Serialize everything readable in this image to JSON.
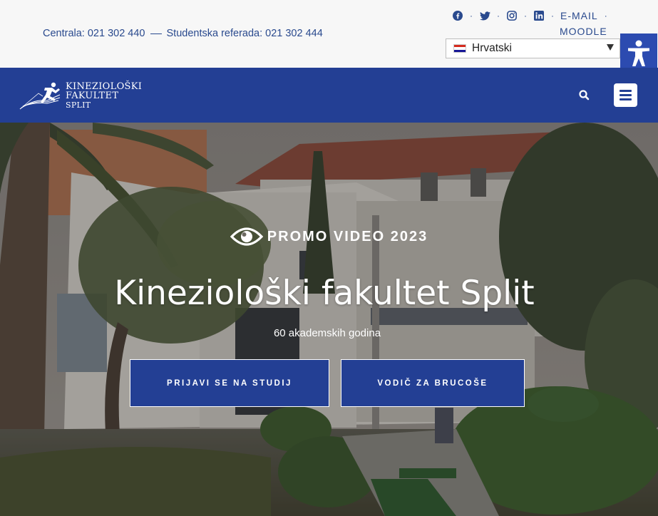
{
  "topbar": {
    "contact_central": "Centrala: 021 302 440",
    "contact_referada": "Studentska referada: 021 302 444",
    "links": {
      "facebook": "facebook-icon",
      "twitter": "twitter-icon",
      "instagram": "instagram-icon",
      "linkedin": "linkedin-icon",
      "email": "E-MAIL",
      "moodle": "MOODLE"
    },
    "language": {
      "selected": "Hrvatski",
      "flag_colors": [
        "#d52b1e",
        "#ffffff",
        "#171796"
      ]
    },
    "accessibility_icon": "accessibility-icon"
  },
  "nav": {
    "logo": {
      "line1": "Kineziološki",
      "line2": "Fakultet",
      "line3": "Split"
    },
    "search_icon": "search-icon",
    "menu_icon": "hamburger-menu-icon"
  },
  "hero": {
    "promo_label": "PROMO VIDEO 2023",
    "title": "Kineziološki fakultet Split",
    "subtitle": "60 akademskih godina",
    "buttons": {
      "apply": "PRIJAVI SE NA STUDIJ",
      "guide": "VODIČ ZA BRUCOŠE"
    }
  },
  "colors": {
    "brand_blue": "#233f94",
    "accessibility_blue": "#2c4bb0",
    "top_text": "#2a4a8e",
    "topbar_bg": "#f7f7f7"
  }
}
